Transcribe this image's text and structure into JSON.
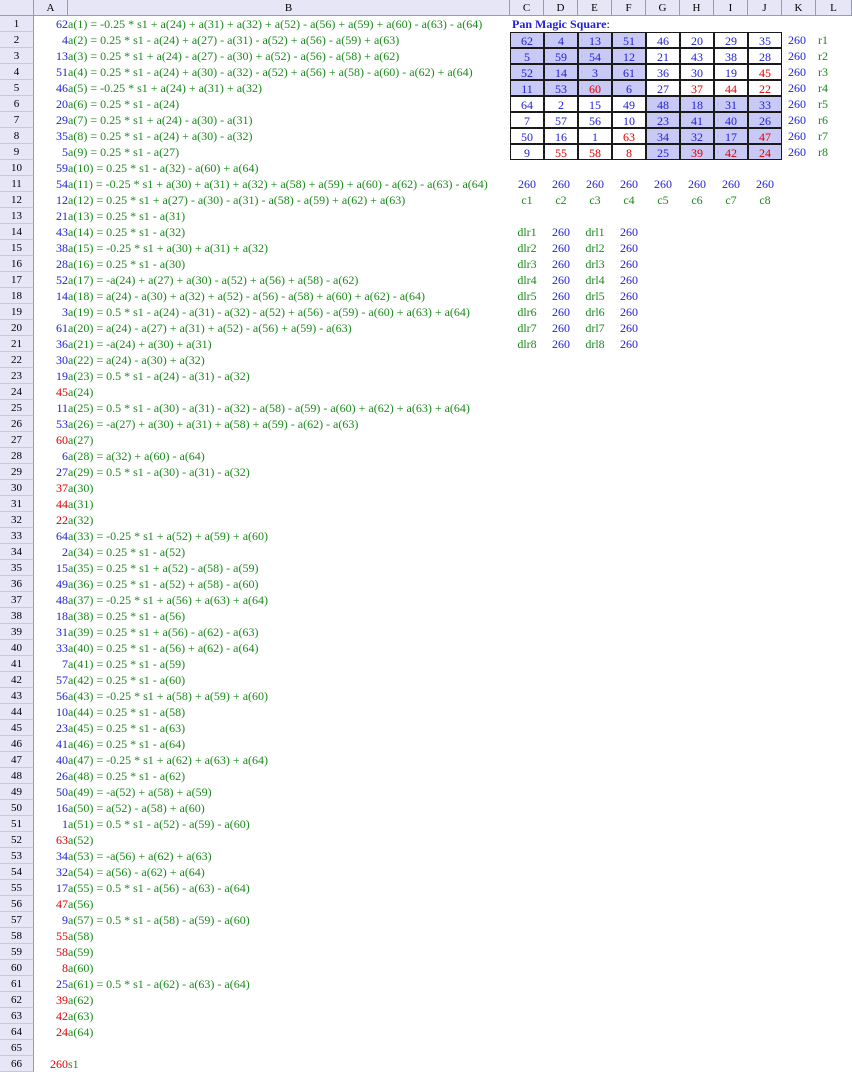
{
  "columns": [
    "A",
    "B",
    "C",
    "D",
    "E",
    "F",
    "G",
    "H",
    "I",
    "J",
    "K",
    "L"
  ],
  "rows": [
    {
      "a": "62",
      "ac": "blue",
      "f": "a(1) = -0.25 * s1 + a(24) + a(31) + a(32) + a(52) - a(56) + a(59) + a(60) - a(63) - a(64)"
    },
    {
      "a": "4",
      "ac": "blue",
      "f": "a(2) = 0.25 * s1 - a(24) + a(27) - a(31) - a(52) + a(56) - a(59) + a(63)"
    },
    {
      "a": "13",
      "ac": "blue",
      "f": "a(3) = 0.25 * s1 + a(24) - a(27) - a(30) + a(52) - a(56) - a(58) + a(62)"
    },
    {
      "a": "51",
      "ac": "blue",
      "f": "a(4) = 0.25 * s1 - a(24) + a(30) - a(32) - a(52) + a(56) + a(58) - a(60) - a(62) + a(64)"
    },
    {
      "a": "46",
      "ac": "blue",
      "f": "a(5) = -0.25 * s1 + a(24) + a(31) + a(32)"
    },
    {
      "a": "20",
      "ac": "blue",
      "f": "a(6) = 0.25 * s1 - a(24)"
    },
    {
      "a": "29",
      "ac": "blue",
      "f": "a(7) = 0.25 * s1 + a(24) - a(30) - a(31)"
    },
    {
      "a": "35",
      "ac": "blue",
      "f": "a(8) = 0.25 * s1 - a(24) + a(30) - a(32)"
    },
    {
      "a": "5",
      "ac": "blue",
      "f": "a(9) = 0.25 * s1 - a(27)"
    },
    {
      "a": "59",
      "ac": "blue",
      "f": "a(10) = 0.25 * s1 - a(32) - a(60) + a(64)"
    },
    {
      "a": "54",
      "ac": "blue",
      "f": "a(11) = -0.25 * s1 + a(30) + a(31) + a(32) + a(58) + a(59) + a(60) - a(62) - a(63) - a(64)"
    },
    {
      "a": "12",
      "ac": "blue",
      "f": "a(12) = 0.25 * s1 + a(27) - a(30) - a(31) - a(58) - a(59) + a(62) + a(63)"
    },
    {
      "a": "21",
      "ac": "blue",
      "f": "a(13) = 0.25 * s1 - a(31)"
    },
    {
      "a": "43",
      "ac": "blue",
      "f": "a(14) = 0.25 * s1 - a(32)"
    },
    {
      "a": "38",
      "ac": "blue",
      "f": "a(15) = -0.25 * s1 + a(30) + a(31) + a(32)"
    },
    {
      "a": "28",
      "ac": "blue",
      "f": "a(16) = 0.25 * s1 - a(30)"
    },
    {
      "a": "52",
      "ac": "blue",
      "f": "a(17) = -a(24) + a(27) + a(30) - a(52) + a(56) + a(58) - a(62)"
    },
    {
      "a": "14",
      "ac": "blue",
      "f": "a(18) = a(24) - a(30) + a(32) + a(52) - a(56) - a(58) + a(60) + a(62) - a(64)"
    },
    {
      "a": "3",
      "ac": "blue",
      "f": "a(19) = 0.5 * s1 - a(24) - a(31) - a(32) - a(52) + a(56) - a(59) - a(60) + a(63) + a(64)"
    },
    {
      "a": "61",
      "ac": "blue",
      "f": "a(20) = a(24) - a(27) + a(31) + a(52) - a(56) + a(59) - a(63)"
    },
    {
      "a": "36",
      "ac": "blue",
      "f": "a(21) = -a(24) + a(30) + a(31)"
    },
    {
      "a": "30",
      "ac": "blue",
      "f": "a(22) = a(24) - a(30) + a(32)"
    },
    {
      "a": "19",
      "ac": "blue",
      "f": "a(23) = 0.5 * s1 - a(24) - a(31) - a(32)"
    },
    {
      "a": "45",
      "ac": "red",
      "f": "a(24)"
    },
    {
      "a": "11",
      "ac": "blue",
      "f": "a(25) = 0.5 * s1 - a(30) - a(31) - a(32) - a(58) - a(59) - a(60) + a(62) + a(63) + a(64)"
    },
    {
      "a": "53",
      "ac": "blue",
      "f": "a(26) = -a(27) + a(30) + a(31) + a(58) + a(59) - a(62) - a(63)"
    },
    {
      "a": "60",
      "ac": "red",
      "f": "a(27)"
    },
    {
      "a": "6",
      "ac": "blue",
      "f": "a(28) = a(32) + a(60) - a(64)"
    },
    {
      "a": "27",
      "ac": "blue",
      "f": "a(29) = 0.5 * s1 - a(30) - a(31) - a(32)"
    },
    {
      "a": "37",
      "ac": "red",
      "f": "a(30)"
    },
    {
      "a": "44",
      "ac": "red",
      "f": "a(31)"
    },
    {
      "a": "22",
      "ac": "red",
      "f": "a(32)"
    },
    {
      "a": "64",
      "ac": "blue",
      "f": "a(33) = -0.25 * s1 + a(52) + a(59) + a(60)"
    },
    {
      "a": "2",
      "ac": "blue",
      "f": "a(34) = 0.25 * s1 - a(52)"
    },
    {
      "a": "15",
      "ac": "blue",
      "f": "a(35) = 0.25 * s1 + a(52) - a(58) - a(59)"
    },
    {
      "a": "49",
      "ac": "blue",
      "f": "a(36) = 0.25 * s1 - a(52) + a(58) - a(60)"
    },
    {
      "a": "48",
      "ac": "blue",
      "f": "a(37) = -0.25 * s1 + a(56) + a(63) + a(64)"
    },
    {
      "a": "18",
      "ac": "blue",
      "f": "a(38) = 0.25 * s1 - a(56)"
    },
    {
      "a": "31",
      "ac": "blue",
      "f": "a(39) = 0.25 * s1 + a(56) - a(62) - a(63)"
    },
    {
      "a": "33",
      "ac": "blue",
      "f": "a(40) = 0.25 * s1 - a(56) + a(62) - a(64)"
    },
    {
      "a": "7",
      "ac": "blue",
      "f": "a(41) = 0.25 * s1 - a(59)"
    },
    {
      "a": "57",
      "ac": "blue",
      "f": "a(42) = 0.25 * s1 - a(60)"
    },
    {
      "a": "56",
      "ac": "blue",
      "f": "a(43) = -0.25 * s1 + a(58) + a(59) + a(60)"
    },
    {
      "a": "10",
      "ac": "blue",
      "f": "a(44) = 0.25 * s1 - a(58)"
    },
    {
      "a": "23",
      "ac": "blue",
      "f": "a(45) = 0.25 * s1 - a(63)"
    },
    {
      "a": "41",
      "ac": "blue",
      "f": "a(46) = 0.25 * s1 - a(64)"
    },
    {
      "a": "40",
      "ac": "blue",
      "f": "a(47) = -0.25 * s1 + a(62) + a(63) + a(64)"
    },
    {
      "a": "26",
      "ac": "blue",
      "f": "a(48) = 0.25 * s1 - a(62)"
    },
    {
      "a": "50",
      "ac": "blue",
      "f": "a(49) = -a(52) + a(58) + a(59)"
    },
    {
      "a": "16",
      "ac": "blue",
      "f": "a(50) = a(52) - a(58) + a(60)"
    },
    {
      "a": "1",
      "ac": "blue",
      "f": "a(51) = 0.5 * s1 - a(52) - a(59) - a(60)"
    },
    {
      "a": "63",
      "ac": "red",
      "f": "a(52)"
    },
    {
      "a": "34",
      "ac": "blue",
      "f": "a(53) = -a(56) + a(62) + a(63)"
    },
    {
      "a": "32",
      "ac": "blue",
      "f": "a(54) = a(56) - a(62) + a(64)"
    },
    {
      "a": "17",
      "ac": "blue",
      "f": "a(55) = 0.5 * s1 - a(56) - a(63) - a(64)"
    },
    {
      "a": "47",
      "ac": "red",
      "f": "a(56)"
    },
    {
      "a": "9",
      "ac": "blue",
      "f": "a(57) = 0.5 * s1 - a(58) - a(59) - a(60)"
    },
    {
      "a": "55",
      "ac": "red",
      "f": "a(58)"
    },
    {
      "a": "58",
      "ac": "red",
      "f": "a(59)"
    },
    {
      "a": "8",
      "ac": "red",
      "f": "a(60)"
    },
    {
      "a": "25",
      "ac": "blue",
      "f": "a(61) = 0.5 * s1 - a(62) - a(63) - a(64)"
    },
    {
      "a": "39",
      "ac": "red",
      "f": "a(62)"
    },
    {
      "a": "42",
      "ac": "red",
      "f": "a(63)"
    },
    {
      "a": "24",
      "ac": "red",
      "f": "a(64)"
    },
    {
      "a": "",
      "ac": "blue",
      "f": ""
    },
    {
      "a": "260",
      "ac": "red",
      "f": "s1"
    }
  ],
  "square": {
    "title": "Pan Magic Square",
    "title_suffix": ":",
    "cells": [
      [
        {
          "v": "62",
          "c": "blue",
          "s": 1
        },
        {
          "v": "4",
          "c": "blue",
          "s": 1
        },
        {
          "v": "13",
          "c": "blue",
          "s": 1
        },
        {
          "v": "51",
          "c": "blue",
          "s": 1
        },
        {
          "v": "46",
          "c": "blue",
          "s": 0
        },
        {
          "v": "20",
          "c": "blue",
          "s": 0
        },
        {
          "v": "29",
          "c": "blue",
          "s": 0
        },
        {
          "v": "35",
          "c": "blue",
          "s": 0
        }
      ],
      [
        {
          "v": "5",
          "c": "blue",
          "s": 1
        },
        {
          "v": "59",
          "c": "blue",
          "s": 1
        },
        {
          "v": "54",
          "c": "blue",
          "s": 1
        },
        {
          "v": "12",
          "c": "blue",
          "s": 1
        },
        {
          "v": "21",
          "c": "blue",
          "s": 0
        },
        {
          "v": "43",
          "c": "blue",
          "s": 0
        },
        {
          "v": "38",
          "c": "blue",
          "s": 0
        },
        {
          "v": "28",
          "c": "blue",
          "s": 0
        }
      ],
      [
        {
          "v": "52",
          "c": "blue",
          "s": 1
        },
        {
          "v": "14",
          "c": "blue",
          "s": 1
        },
        {
          "v": "3",
          "c": "blue",
          "s": 1
        },
        {
          "v": "61",
          "c": "blue",
          "s": 1
        },
        {
          "v": "36",
          "c": "blue",
          "s": 0
        },
        {
          "v": "30",
          "c": "blue",
          "s": 0
        },
        {
          "v": "19",
          "c": "blue",
          "s": 0
        },
        {
          "v": "45",
          "c": "red",
          "s": 0
        }
      ],
      [
        {
          "v": "11",
          "c": "blue",
          "s": 1
        },
        {
          "v": "53",
          "c": "blue",
          "s": 1
        },
        {
          "v": "60",
          "c": "red",
          "s": 1
        },
        {
          "v": "6",
          "c": "blue",
          "s": 1
        },
        {
          "v": "27",
          "c": "blue",
          "s": 0
        },
        {
          "v": "37",
          "c": "red",
          "s": 0
        },
        {
          "v": "44",
          "c": "red",
          "s": 0
        },
        {
          "v": "22",
          "c": "red",
          "s": 0
        }
      ],
      [
        {
          "v": "64",
          "c": "blue",
          "s": 0
        },
        {
          "v": "2",
          "c": "blue",
          "s": 0
        },
        {
          "v": "15",
          "c": "blue",
          "s": 0
        },
        {
          "v": "49",
          "c": "blue",
          "s": 0
        },
        {
          "v": "48",
          "c": "blue",
          "s": 1
        },
        {
          "v": "18",
          "c": "blue",
          "s": 1
        },
        {
          "v": "31",
          "c": "blue",
          "s": 1
        },
        {
          "v": "33",
          "c": "blue",
          "s": 1
        }
      ],
      [
        {
          "v": "7",
          "c": "blue",
          "s": 0
        },
        {
          "v": "57",
          "c": "blue",
          "s": 0
        },
        {
          "v": "56",
          "c": "blue",
          "s": 0
        },
        {
          "v": "10",
          "c": "blue",
          "s": 0
        },
        {
          "v": "23",
          "c": "blue",
          "s": 1
        },
        {
          "v": "41",
          "c": "blue",
          "s": 1
        },
        {
          "v": "40",
          "c": "blue",
          "s": 1
        },
        {
          "v": "26",
          "c": "blue",
          "s": 1
        }
      ],
      [
        {
          "v": "50",
          "c": "blue",
          "s": 0
        },
        {
          "v": "16",
          "c": "blue",
          "s": 0
        },
        {
          "v": "1",
          "c": "blue",
          "s": 0
        },
        {
          "v": "63",
          "c": "red",
          "s": 0
        },
        {
          "v": "34",
          "c": "blue",
          "s": 1
        },
        {
          "v": "32",
          "c": "blue",
          "s": 1
        },
        {
          "v": "17",
          "c": "blue",
          "s": 1
        },
        {
          "v": "47",
          "c": "red",
          "s": 1
        }
      ],
      [
        {
          "v": "9",
          "c": "blue",
          "s": 0
        },
        {
          "v": "55",
          "c": "red",
          "s": 0
        },
        {
          "v": "58",
          "c": "red",
          "s": 0
        },
        {
          "v": "8",
          "c": "red",
          "s": 0
        },
        {
          "v": "25",
          "c": "blue",
          "s": 1
        },
        {
          "v": "39",
          "c": "red",
          "s": 1
        },
        {
          "v": "42",
          "c": "red",
          "s": 1
        },
        {
          "v": "24",
          "c": "red",
          "s": 1
        }
      ]
    ],
    "row_sums": [
      "260",
      "260",
      "260",
      "260",
      "260",
      "260",
      "260",
      "260"
    ],
    "row_labels": [
      "r1",
      "r2",
      "r3",
      "r4",
      "r5",
      "r6",
      "r7",
      "r8"
    ],
    "col_sums": [
      "260",
      "260",
      "260",
      "260",
      "260",
      "260",
      "260",
      "260"
    ],
    "col_labels": [
      "c1",
      "c2",
      "c3",
      "c4",
      "c5",
      "c6",
      "c7",
      "c8"
    ],
    "diagonals": [
      {
        "l1": "dlr1",
        "v1": "260",
        "l2": "drl1",
        "v2": "260"
      },
      {
        "l1": "dlr2",
        "v1": "260",
        "l2": "drl2",
        "v2": "260"
      },
      {
        "l1": "dlr3",
        "v1": "260",
        "l2": "drl3",
        "v2": "260"
      },
      {
        "l1": "dlr4",
        "v1": "260",
        "l2": "drl4",
        "v2": "260"
      },
      {
        "l1": "dlr5",
        "v1": "260",
        "l2": "drl5",
        "v2": "260"
      },
      {
        "l1": "dlr6",
        "v1": "260",
        "l2": "drl6",
        "v2": "260"
      },
      {
        "l1": "dlr7",
        "v1": "260",
        "l2": "drl7",
        "v2": "260"
      },
      {
        "l1": "dlr8",
        "v1": "260",
        "l2": "drl8",
        "v2": "260"
      }
    ]
  },
  "colors": {
    "blue": "#1f1fd6",
    "red": "#e00000",
    "green": "#1a8a1a",
    "header_bg": "#e6e6f7",
    "shade": "#c9c9f5"
  }
}
